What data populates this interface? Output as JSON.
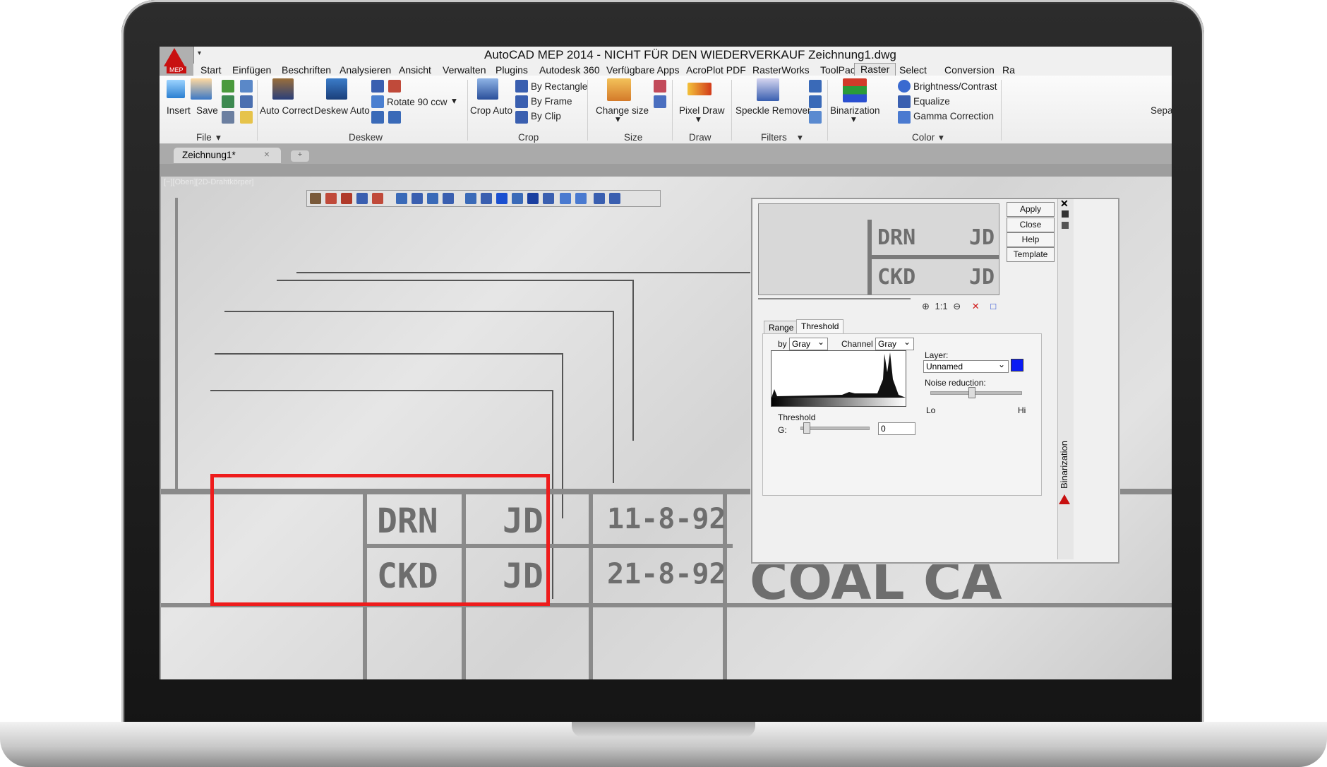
{
  "window": {
    "title": "AutoCAD MEP 2014 - NICHT FÜR DEN WIEDERVERKAUF     Zeichnung1.dwg",
    "app_badge": "MEP"
  },
  "tabs": [
    "Start",
    "Einfügen",
    "Beschriften",
    "Analysieren",
    "Ansicht",
    "Verwalten",
    "Plugins",
    "Autodesk 360",
    "Verfügbare Apps",
    "AcroPlot PDF",
    "RasterWorks",
    "ToolPac",
    "Raster",
    "Select",
    "Conversion",
    "Ra"
  ],
  "active_tab": "Raster",
  "ribbon": {
    "file": {
      "insert": "Insert",
      "save": "Save",
      "group": "File"
    },
    "deskew": {
      "auto_correct": "Auto Correct",
      "deskew_auto": "Deskew Auto",
      "rotate": "Rotate 90 ccw",
      "group": "Deskew"
    },
    "crop": {
      "crop_auto": "Crop Auto",
      "by_rectangle": "By Rectangle",
      "by_frame": "By Frame",
      "by_clip": "By Clip",
      "group": "Crop"
    },
    "size": {
      "change_size": "Change size",
      "group": "Size"
    },
    "draw": {
      "pixel_draw": "Pixel Draw",
      "group": "Draw"
    },
    "filters": {
      "speckle_remover": "Speckle Remover",
      "group": "Filters"
    },
    "color": {
      "binarization": "Binarization",
      "brightness": "Brightness/Contrast",
      "equalize": "Equalize",
      "gamma": "Gamma Correction",
      "group": "Color"
    },
    "extra": "Sepa"
  },
  "doc_tab": {
    "name": "Zeichnung1*",
    "close": "×"
  },
  "viewport_label": "[−][Oben][2D-Drahtkörper]",
  "drawing": {
    "drn": "DRN",
    "ckd": "CKD",
    "jd": "JD",
    "date1": "11-8-92",
    "date2": "21-8-92",
    "coal": "COAL",
    "ca": "CA"
  },
  "dialog": {
    "buttons": {
      "apply": "Apply",
      "close": "Close",
      "help": "Help",
      "template": "Template"
    },
    "side_label": "Binarization",
    "tabs": {
      "range": "Range",
      "threshold": "Threshold"
    },
    "by_label": "by",
    "by_value": "Gray",
    "channel_label": "Channel",
    "channel_value": "Gray",
    "layer_label": "Layer:",
    "layer_value": "Unnamed",
    "noise_label": "Noise reduction:",
    "lo": "Lo",
    "hi": "Hi",
    "threshold_group": "Threshold",
    "g_label": "G:",
    "g_value": "0",
    "layer_color": "#0a1bf5"
  }
}
